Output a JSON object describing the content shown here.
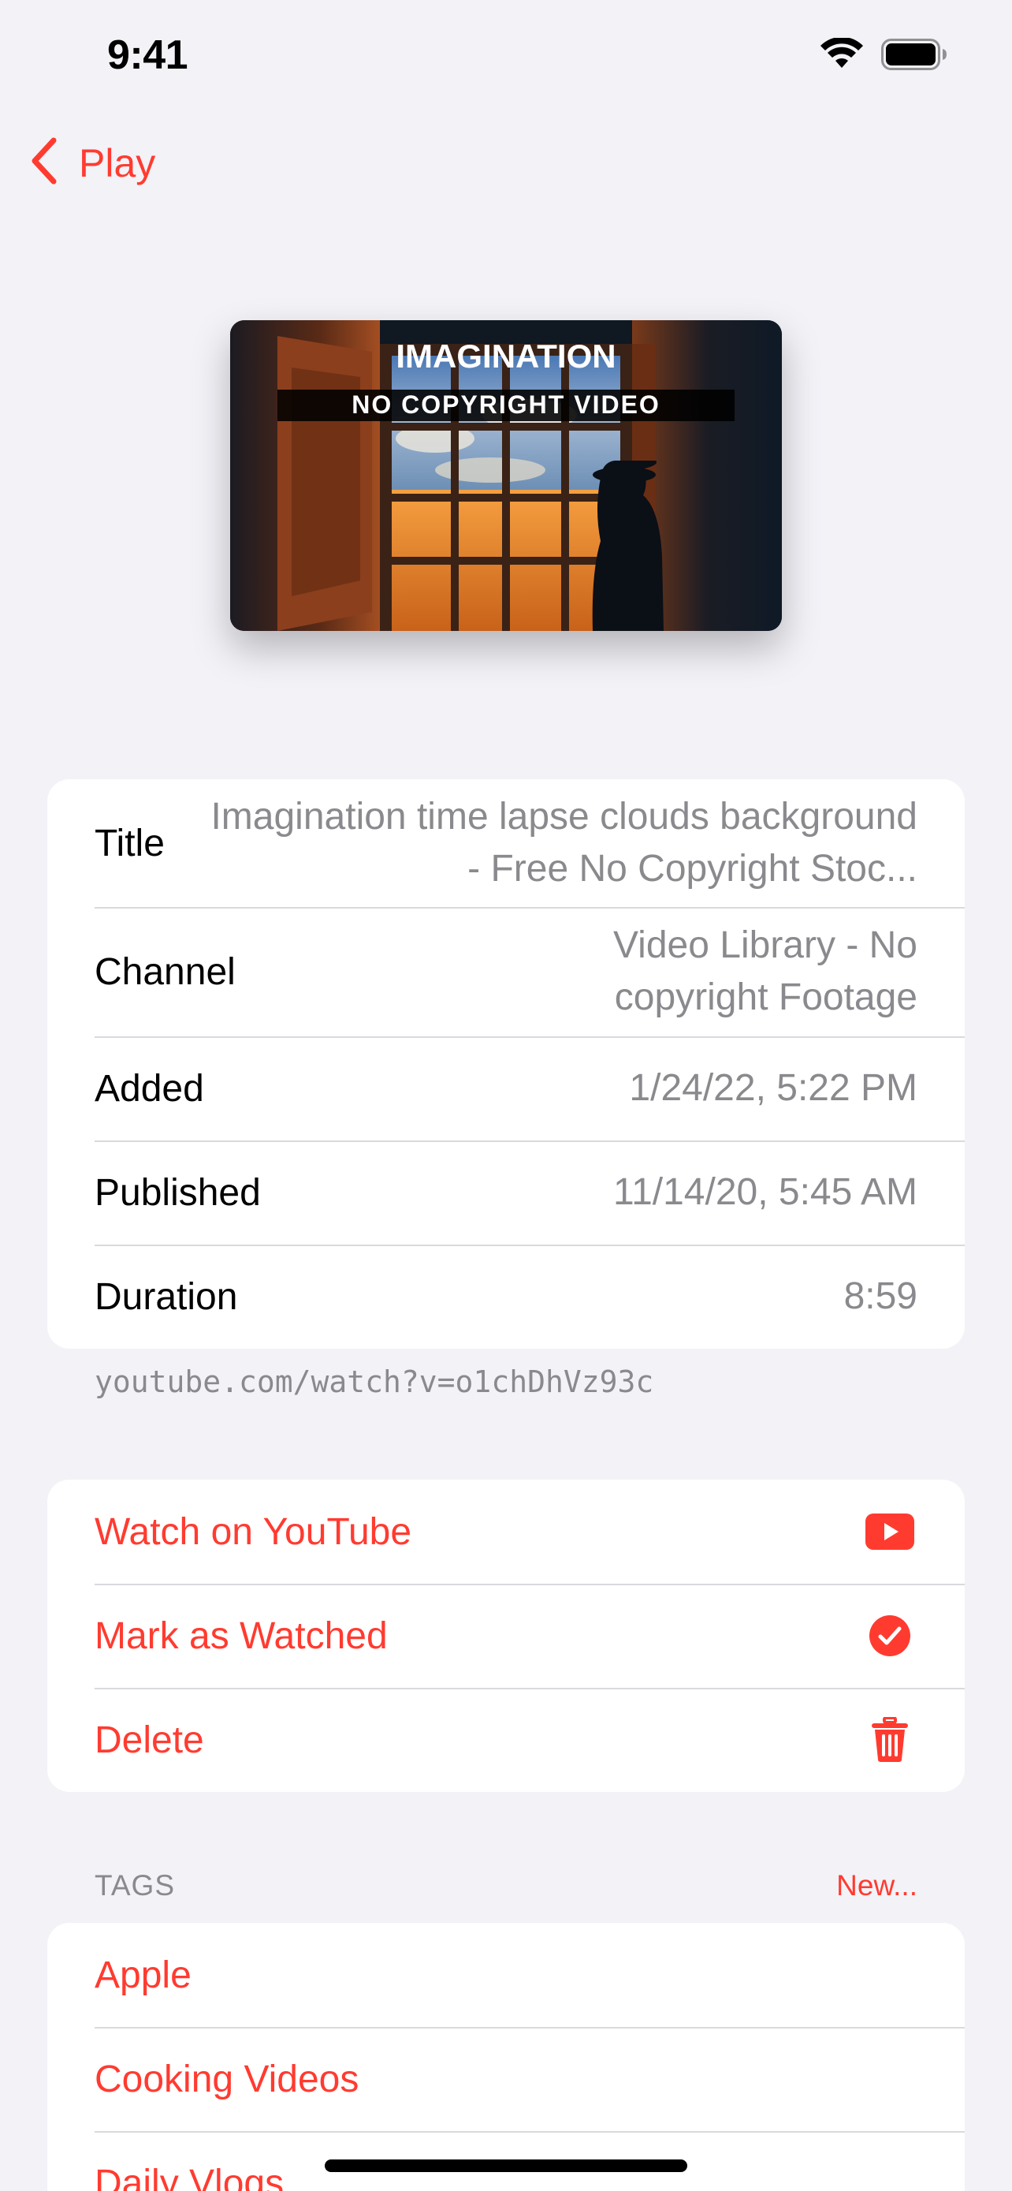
{
  "status_bar": {
    "time": "9:41",
    "icons": [
      "wifi-icon",
      "battery-icon"
    ]
  },
  "nav": {
    "back_label": "Play",
    "back_icon": "chevron-left-icon"
  },
  "thumbnail": {
    "title_line1": "IMAGINATION",
    "title_line2": "NO COPYRIGHT VIDEO"
  },
  "info": {
    "rows": [
      {
        "label": "Title",
        "value": "Imagination  time lapse clouds background - Free No Copyright Stoc..."
      },
      {
        "label": "Channel",
        "value": "Video Library - No copyright Footage"
      },
      {
        "label": "Added",
        "value": "1/24/22, 5:22 PM"
      },
      {
        "label": "Published",
        "value": "11/14/20, 5:45 AM"
      },
      {
        "label": "Duration",
        "value": "8:59"
      }
    ],
    "url": "youtube.com/watch?v=o1chDhVz93c"
  },
  "actions": [
    {
      "label": "Watch on YouTube",
      "icon": "youtube-play-icon"
    },
    {
      "label": "Mark as Watched",
      "icon": "checkmark-circle-icon"
    },
    {
      "label": "Delete",
      "icon": "trash-icon"
    }
  ],
  "tags": {
    "header": "TAGS",
    "new_label": "New...",
    "items": [
      "Apple",
      "Cooking Videos",
      "Daily Vlogs"
    ]
  },
  "colors": {
    "accent": "#ff3b30",
    "background": "#f2f2f7",
    "secondary_text": "#8a8a8e"
  }
}
